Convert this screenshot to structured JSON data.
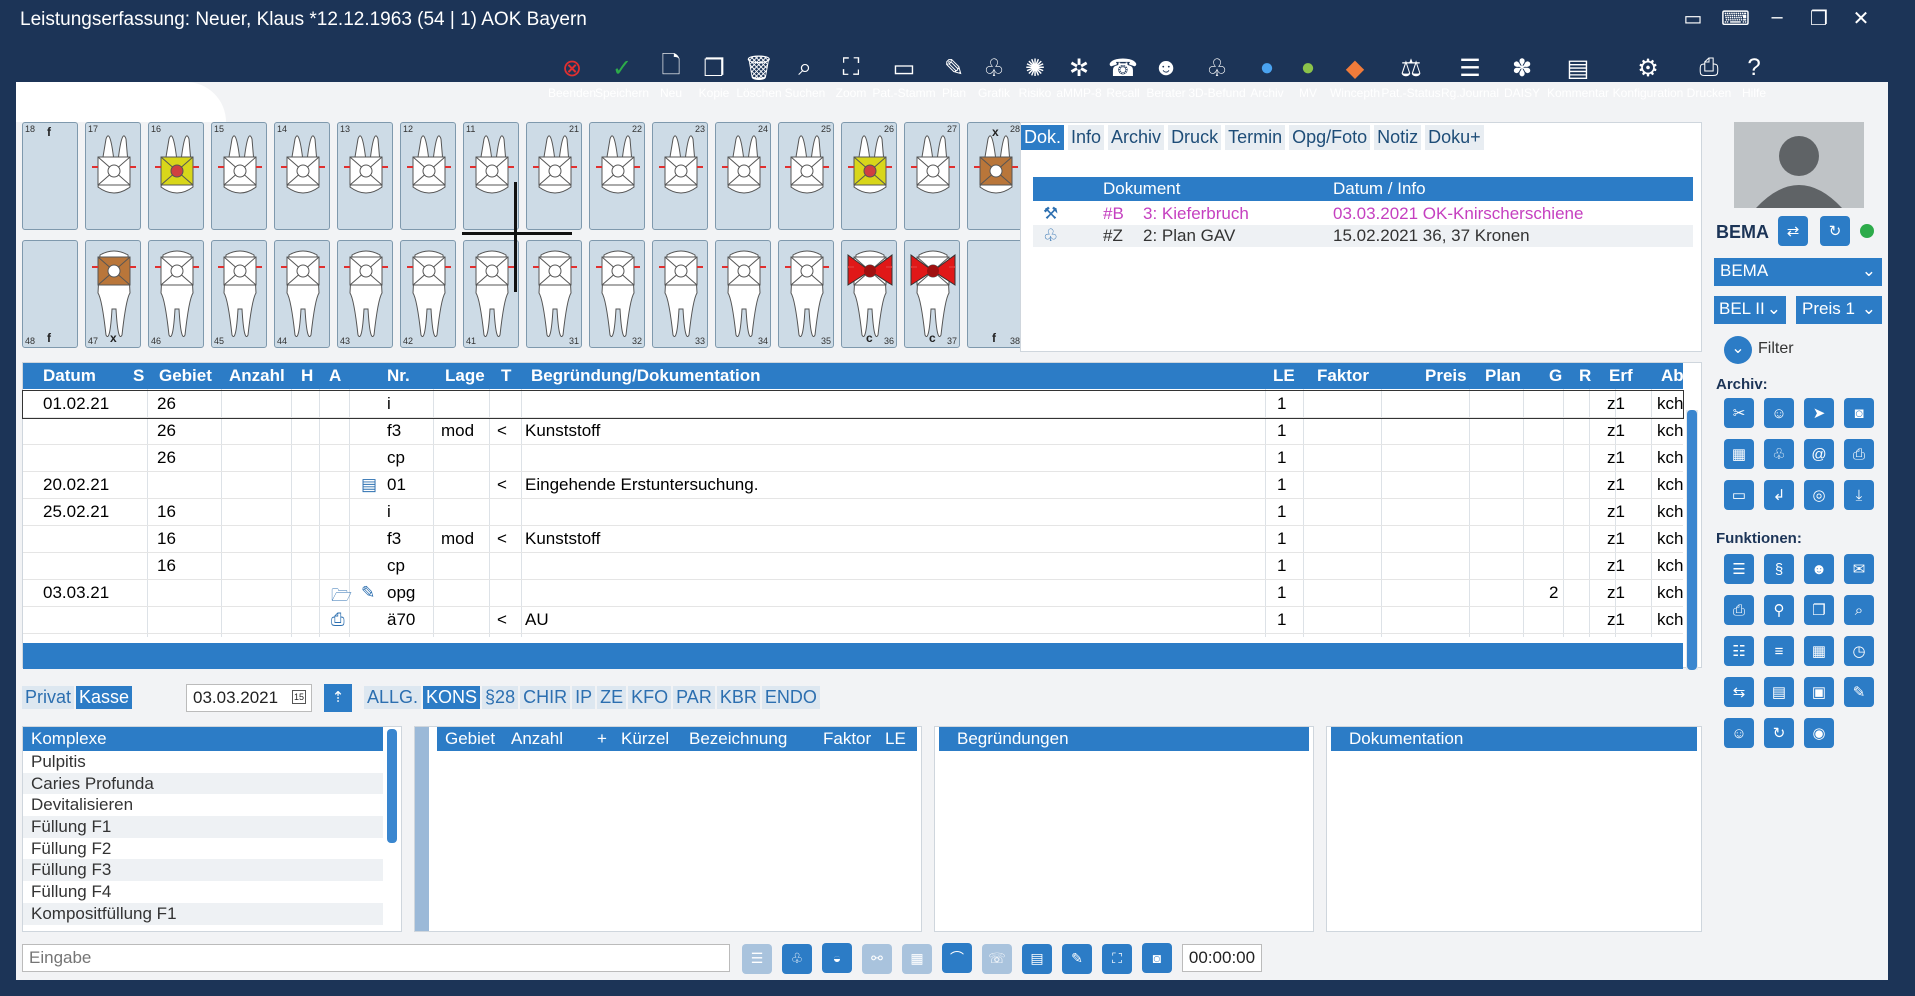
{
  "window": {
    "title": "Leistungserfassung: Neuer, Klaus *12.12.1963 (54 |  1) AOK Bayern"
  },
  "toolbar": [
    {
      "label": "Beenden",
      "icon": "close-circle-icon",
      "glyph": "⊗",
      "color": "#e03030"
    },
    {
      "label": "Speichern",
      "icon": "check-circle-icon",
      "glyph": "✓",
      "color": "#2dab4a"
    },
    {
      "label": "Neu",
      "icon": "new-document-icon",
      "glyph": "🗋"
    },
    {
      "label": "Kopie",
      "icon": "copy-icon",
      "glyph": "❐"
    },
    {
      "label": "Löschen",
      "icon": "trash-icon",
      "glyph": "🗑"
    },
    {
      "label": "Suchen",
      "icon": "search-icon",
      "glyph": "⌕"
    },
    {
      "label": "Zoom",
      "icon": "zoom-icon",
      "glyph": "⛶"
    },
    {
      "label": "Pat.-Stamm",
      "icon": "patient-card-icon",
      "glyph": "▭"
    },
    {
      "label": "Plan",
      "icon": "plan-icon",
      "glyph": "✎"
    },
    {
      "label": "Grafik",
      "icon": "tooth-icon",
      "glyph": "♧"
    },
    {
      "label": "Risiko",
      "icon": "risk-icon",
      "glyph": "✺"
    },
    {
      "label": "aMMP-8",
      "icon": "ammp8-icon",
      "glyph": "✲"
    },
    {
      "label": "Recall",
      "icon": "recall-icon",
      "glyph": "☎"
    },
    {
      "label": "Berater",
      "icon": "advisor-icon",
      "glyph": "☻"
    },
    {
      "label": "3D-Befund",
      "icon": "tooth-3d-icon",
      "glyph": "♧"
    },
    {
      "label": "Archiv",
      "icon": "archive-globe-icon",
      "glyph": "●",
      "color": "#4aa3f0"
    },
    {
      "label": "MV",
      "icon": "mv-icon",
      "glyph": "●",
      "color": "#8bc34a"
    },
    {
      "label": "Wincepth",
      "icon": "wincepth-icon",
      "glyph": "◆",
      "color": "#f07b3a"
    },
    {
      "label": "Pat.-Status",
      "icon": "patient-status-icon",
      "glyph": "⚖"
    },
    {
      "label": "Rg.Journal",
      "icon": "journal-icon",
      "glyph": "☰"
    },
    {
      "label": "DAISY",
      "icon": "daisy-icon",
      "glyph": "✽"
    },
    {
      "label": "Kommentar",
      "icon": "comment-icon",
      "glyph": "▤"
    },
    {
      "label": "Konfiguration",
      "icon": "gear-icon",
      "glyph": "⚙"
    },
    {
      "label": "Drucken",
      "icon": "printer-icon",
      "glyph": "⎙"
    },
    {
      "label": "Hilfe",
      "icon": "help-icon",
      "glyph": "?"
    }
  ],
  "teeth": {
    "upper": [
      {
        "n": "18",
        "mk": "f",
        "t": "empty"
      },
      {
        "n": "17",
        "t": "tooth"
      },
      {
        "n": "16",
        "t": "yellow"
      },
      {
        "n": "15",
        "t": "tooth"
      },
      {
        "n": "14",
        "t": "tooth"
      },
      {
        "n": "13",
        "t": "tooth"
      },
      {
        "n": "12",
        "t": "tooth"
      },
      {
        "n": "11",
        "t": "tooth"
      },
      {
        "n": "21",
        "t": "tooth"
      },
      {
        "n": "22",
        "t": "tooth"
      },
      {
        "n": "23",
        "t": "tooth"
      },
      {
        "n": "24",
        "t": "tooth"
      },
      {
        "n": "25",
        "t": "tooth"
      },
      {
        "n": "26",
        "t": "yellow"
      },
      {
        "n": "27",
        "t": "tooth"
      },
      {
        "n": "28",
        "mk": "x",
        "t": "brown"
      }
    ],
    "lower": [
      {
        "n": "48",
        "mk": "f",
        "t": "empty"
      },
      {
        "n": "47",
        "mk": "x",
        "t": "brown"
      },
      {
        "n": "46",
        "t": "tooth"
      },
      {
        "n": "45",
        "t": "tooth"
      },
      {
        "n": "44",
        "t": "tooth"
      },
      {
        "n": "43",
        "t": "tooth"
      },
      {
        "n": "42",
        "t": "tooth"
      },
      {
        "n": "41",
        "t": "tooth"
      },
      {
        "n": "31",
        "t": "tooth"
      },
      {
        "n": "32",
        "t": "tooth"
      },
      {
        "n": "33",
        "t": "tooth"
      },
      {
        "n": "34",
        "t": "tooth"
      },
      {
        "n": "35",
        "t": "tooth"
      },
      {
        "n": "36",
        "mk": "c",
        "t": "red"
      },
      {
        "n": "37",
        "mk": "c",
        "t": "red"
      },
      {
        "n": "38",
        "mk": "f",
        "t": "empty"
      }
    ]
  },
  "doc": {
    "tabs": [
      "Dok.",
      "Info",
      "Archiv",
      "Druck",
      "Termin",
      "Opg/Foto",
      "Notiz",
      "Doku+"
    ],
    "columns": [
      "Dokument",
      "Datum / Info"
    ],
    "rows": [
      {
        "code": "#B",
        "doc": "3: Kieferbruch",
        "info": "03.03.2021 OK-Knirscherschiene",
        "color": "#c540c0",
        "icon": "wrench-icon"
      },
      {
        "code": "#Z",
        "doc": "2: Plan GAV",
        "info": "15.02.2021 36, 37 Kronen",
        "color": "#333",
        "icon": "tooth-icon"
      }
    ]
  },
  "patient": {
    "label": "BEMA",
    "status_color": "#2dab4a"
  },
  "selectors": {
    "catalog": "BEMA",
    "bel": "BEL II",
    "price": "Preis 1",
    "filter": "Filter"
  },
  "sidebar": {
    "archiv_title": "Archiv:",
    "funktionen_title": "Funktionen:"
  },
  "table": {
    "columns": [
      "Datum",
      "S",
      "Gebiet",
      "Anzahl",
      "H",
      "A",
      "Nr.",
      "Lage",
      "T",
      "Begründung/Dokumentation",
      "LE",
      "Faktor",
      "Preis",
      "Plan",
      "G",
      "R",
      "Erf",
      "Abr."
    ],
    "rows": [
      {
        "datum": "01.02.21",
        "gebiet": "26",
        "nr": "i",
        "lage": "",
        "t": "",
        "beg": "",
        "le": "1",
        "g": "",
        "erf": "z1",
        "abr": "kch",
        "a": "",
        "h": ""
      },
      {
        "datum": "",
        "gebiet": "26",
        "nr": "f3",
        "lage": "mod",
        "t": "<",
        "beg": "Kunststoff",
        "le": "1",
        "g": "",
        "erf": "z1",
        "abr": "kch",
        "a": "",
        "h": ""
      },
      {
        "datum": "",
        "gebiet": "26",
        "nr": "cp",
        "lage": "",
        "t": "",
        "beg": "",
        "le": "1",
        "g": "",
        "erf": "z1",
        "abr": "kch",
        "a": "",
        "h": ""
      },
      {
        "datum": "20.02.21",
        "gebiet": "",
        "nr": "01",
        "lage": "",
        "t": "<",
        "beg": "Eingehende Erstuntersuchung.",
        "le": "1",
        "g": "",
        "erf": "z1",
        "abr": "kch",
        "a": "▤",
        "h": ""
      },
      {
        "datum": "25.02.21",
        "gebiet": "16",
        "nr": "i",
        "lage": "",
        "t": "",
        "beg": "",
        "le": "1",
        "g": "",
        "erf": "z1",
        "abr": "kch",
        "a": "",
        "h": ""
      },
      {
        "datum": "",
        "gebiet": "16",
        "nr": "f3",
        "lage": "mod",
        "t": "<",
        "beg": "Kunststoff",
        "le": "1",
        "g": "",
        "erf": "z1",
        "abr": "kch",
        "a": "",
        "h": ""
      },
      {
        "datum": "",
        "gebiet": "16",
        "nr": "cp",
        "lage": "",
        "t": "",
        "beg": "",
        "le": "1",
        "g": "",
        "erf": "z1",
        "abr": "kch",
        "a": "",
        "h": ""
      },
      {
        "datum": "03.03.21",
        "gebiet": "",
        "nr": "opg",
        "lage": "",
        "t": "",
        "beg": "",
        "le": "1",
        "g": "2",
        "erf": "z1",
        "abr": "kch",
        "a": "✎",
        "h": "🗁"
      },
      {
        "datum": "",
        "gebiet": "",
        "nr": "ä70",
        "lage": "",
        "t": "<",
        "beg": "AU",
        "le": "1",
        "g": "",
        "erf": "z1",
        "abr": "kch",
        "a": "",
        "h": "⎙"
      }
    ]
  },
  "filters": {
    "privat": "Privat",
    "kasse": "Kasse",
    "date": "03.03.2021",
    "date_icon": "15",
    "cats": [
      "ALLG.",
      "KONS",
      "§28",
      "CHIR",
      "IP",
      "ZE",
      "KFO",
      "PAR",
      "KBR",
      "ENDO"
    ],
    "active": "KONS"
  },
  "komplexe": {
    "header": "Komplexe",
    "items": [
      "Pulpitis",
      "Caries Profunda",
      "Devitalisieren",
      "Füllung F1",
      "Füllung F2",
      "Füllung F3",
      "Füllung F4",
      "Kompositfüllung F1"
    ]
  },
  "gebiet": {
    "columns": [
      "Gebiet",
      "Anzahl",
      "+",
      "Kürzel",
      "Bezeichnung",
      "Faktor",
      "LE"
    ]
  },
  "begruendungen": {
    "header": "Begründungen"
  },
  "dokumentation": {
    "header": "Dokumentation"
  },
  "input": {
    "placeholder": "Eingabe"
  },
  "timer": "00:00:00"
}
